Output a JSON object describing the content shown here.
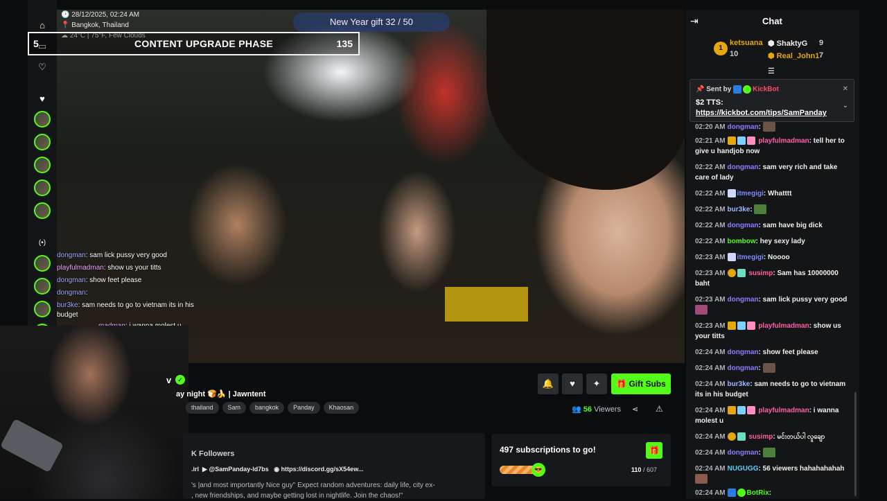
{
  "overlay": {
    "datetime": "28/12/2025, 02:24 AM",
    "location": "Bangkok, Thailand",
    "weather": "24°C | 75°F, Few Clouds",
    "gift_goal": "New Year gift 32 / 50",
    "phase_title": "CONTENT UPGRADE PHASE",
    "phase_value": "135",
    "phase_left": "5",
    "overlay_chat": [
      {
        "user": "dongman",
        "text": ": sam lick pussy very good"
      },
      {
        "user": "playfulmadman",
        "text": ": show us your titts"
      },
      {
        "user": "dongman",
        "text": ": show feet please"
      },
      {
        "user": "dongman",
        "text": ":"
      },
      {
        "user": "bur3ke",
        "text": ": sam needs to go to vietnam its in his budget"
      },
      {
        "user": "madman",
        "text": ": i wanna molest u"
      }
    ]
  },
  "stream": {
    "title_fragment": "ay night 🍞🍌 | Jawntent",
    "name_fragment": "v",
    "tags": [
      "thailand",
      "Sam",
      "bangkok",
      "Panday",
      "Khaosan"
    ],
    "viewers_count": "56",
    "viewers_label": "Viewers",
    "gift_subs_label": "Gift Subs",
    "followers_label": "K Followers",
    "youtube": "@SamPanday-ld7bs",
    "link_prefix": ".irl",
    "discord": "https://discord.gg/sX54ew...",
    "description": "'s |and most importantly Nice guy\" Expect random adventures: daily life, city ex-",
    "description2": ", new friendships, and maybe getting lost in nightlife. Join the chaos!\""
  },
  "subs_goal": {
    "title": "497 subscriptions to go!",
    "current": "110",
    "total": "/ 607",
    "progress": 0.18
  },
  "chat": {
    "title": "Chat",
    "leaderboard": [
      {
        "rank": "1",
        "name": "ketsuana",
        "count": "10"
      },
      {
        "name": "ShaktyG",
        "count": "9"
      },
      {
        "name": "Real_John1",
        "count": "7"
      }
    ],
    "pinned": {
      "sent_by_label": "Sent by",
      "sender": "KickBot",
      "line1": "$2 TTS:",
      "line2": "https://kickbot.com/tips/SamPanday"
    },
    "messages": [
      {
        "time": "02:20 AM",
        "user": "dongman",
        "text": ":",
        "cls": "n1"
      },
      {
        "time": "02:21 AM",
        "user": "playfulmadman",
        "text": ": tell her to give u handjob now",
        "cls": "n2"
      },
      {
        "time": "02:22 AM",
        "user": "dongman",
        "text": ": sam very rich and take care of lady",
        "cls": "n1"
      },
      {
        "time": "02:22 AM",
        "user": "itmegigi",
        "text": ": Whatttt",
        "cls": "n3"
      },
      {
        "time": "02:22 AM",
        "user": "bur3ke",
        "text": ":",
        "cls": "n6"
      },
      {
        "time": "02:22 AM",
        "user": "dongman",
        "text": ": sam have big dick",
        "cls": "n1"
      },
      {
        "time": "02:22 AM",
        "user": "bombow",
        "text": ": hey sexy lady",
        "cls": "n4"
      },
      {
        "time": "02:23 AM",
        "user": "itmegigi",
        "text": ": Noooo",
        "cls": "n3"
      },
      {
        "time": "02:23 AM",
        "user": "susimp",
        "text": ": Sam has 10000000 baht",
        "cls": "n2"
      },
      {
        "time": "02:23 AM",
        "user": "dongman",
        "text": ": sam lick pussy very good",
        "cls": "n1"
      },
      {
        "time": "02:23 AM",
        "user": "playfulmadman",
        "text": ": show us your titts",
        "cls": "n2"
      },
      {
        "time": "02:24 AM",
        "user": "dongman",
        "text": ": show feet please",
        "cls": "n1"
      },
      {
        "time": "02:24 AM",
        "user": "dongman",
        "text": ":",
        "cls": "n1"
      },
      {
        "time": "02:24 AM",
        "user": "bur3ke",
        "text": ": sam needs to go to vietnam its in his budget",
        "cls": "n6"
      },
      {
        "time": "02:24 AM",
        "user": "playfulmadman",
        "text": ": i wanna molest u",
        "cls": "n2"
      },
      {
        "time": "02:24 AM",
        "user": "susimp",
        "text": ": မင်းတယ်ပါ လူချော",
        "cls": "n2"
      },
      {
        "time": "02:24 AM",
        "user": "dongman",
        "text": ":",
        "cls": "n1"
      },
      {
        "time": "02:24 AM",
        "user": "NUGUGG",
        "text": ": 56 viewers hahahahahah",
        "cls": "n5"
      },
      {
        "time": "02:24 AM",
        "user": "BotRix",
        "text": ":",
        "cls": "n4"
      }
    ]
  },
  "colors": {
    "accent": "#53fc18",
    "bg": "#0b0c0e",
    "panel": "#141517"
  }
}
